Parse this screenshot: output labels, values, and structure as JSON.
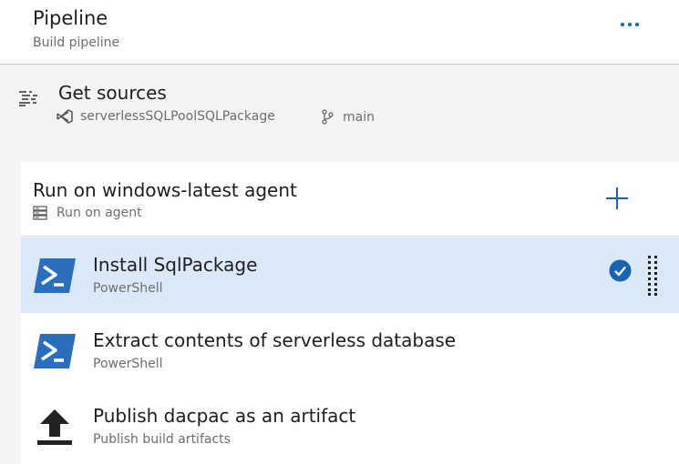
{
  "header": {
    "title": "Pipeline",
    "subtitle": "Build pipeline",
    "more_icon": "ellipsis-icon"
  },
  "sources": {
    "title": "Get sources",
    "repository": "serverlessSQLPoolSQLPackage",
    "branch": "main",
    "icon": "sources-list-icon"
  },
  "job": {
    "title": "Run on windows-latest agent",
    "subtitle": "Run on agent",
    "add_icon": "plus-icon"
  },
  "tasks": [
    {
      "name": "Install SqlPackage",
      "type": "PowerShell",
      "icon": "powershell-icon",
      "selected": true,
      "enabled": true
    },
    {
      "name": "Extract contents of serverless database",
      "type": "PowerShell",
      "icon": "powershell-icon",
      "selected": false
    },
    {
      "name": "Publish dacpac as an artifact",
      "type": "Publish build artifacts",
      "icon": "upload-icon",
      "selected": false
    }
  ],
  "colors": {
    "accent": "#1a62b5",
    "selected_row": "#dbe8f7",
    "powershell": "#2a6fbd"
  }
}
